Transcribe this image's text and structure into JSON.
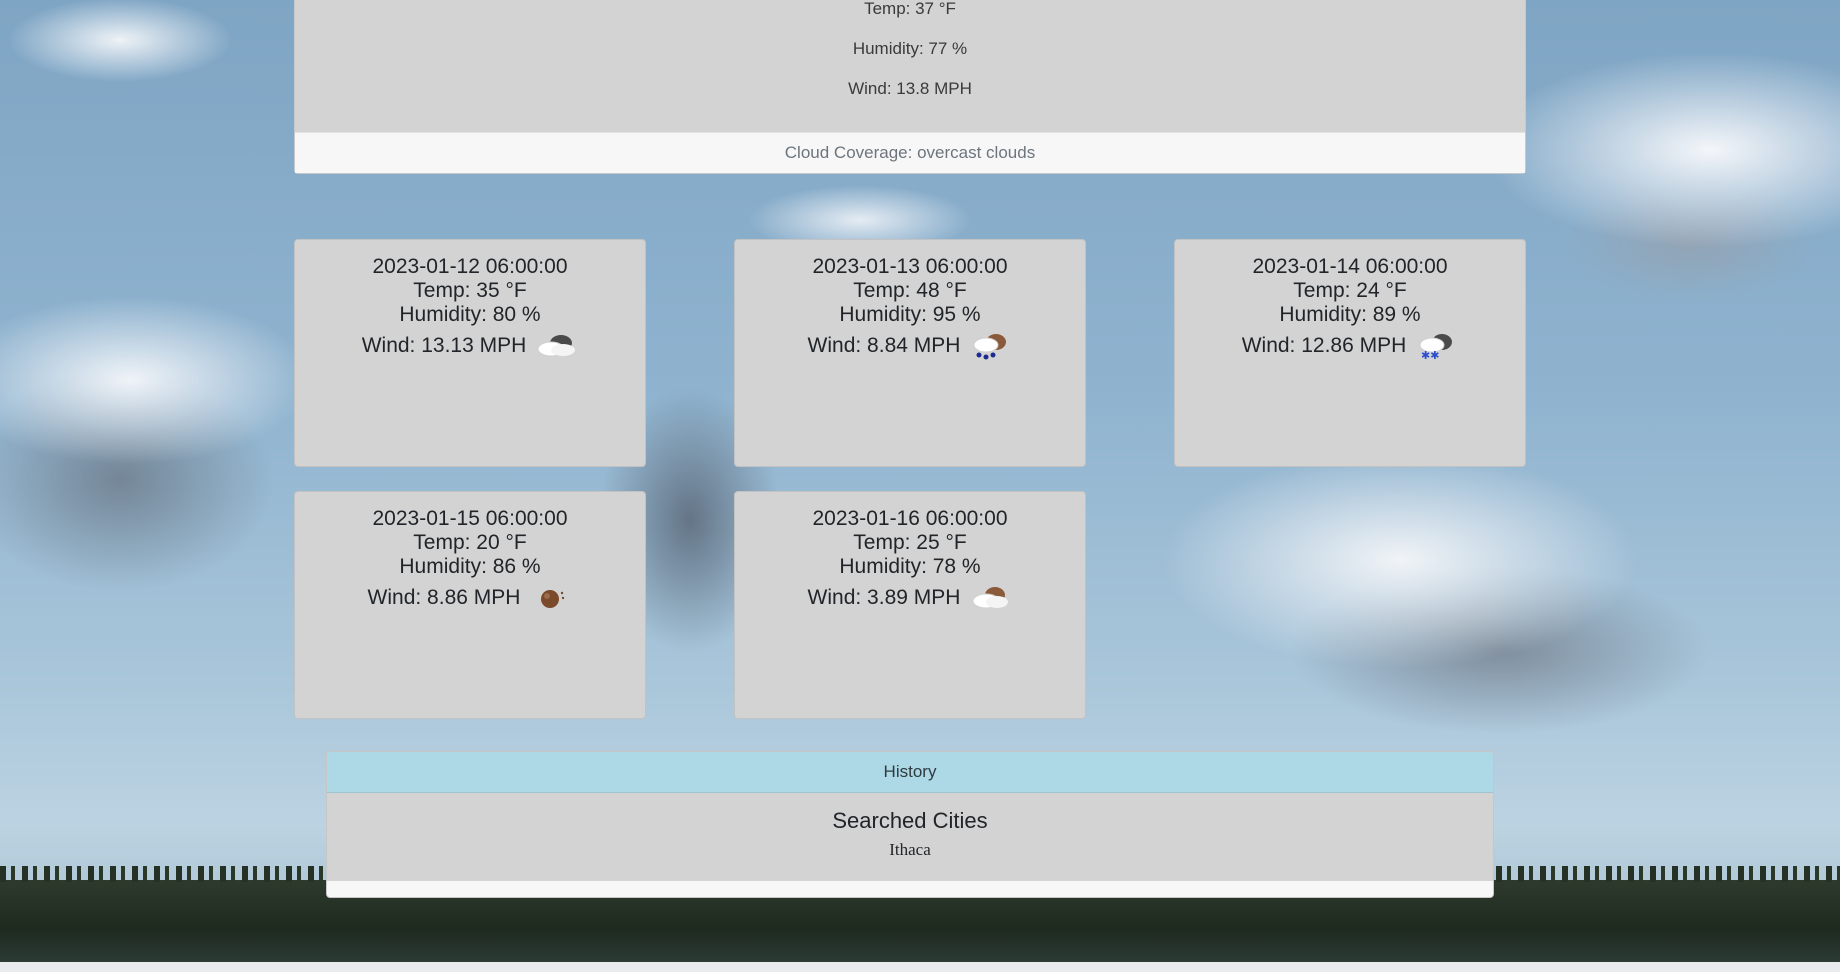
{
  "current": {
    "temp": "Temp: 37 °F",
    "humidity": "Humidity: 77 %",
    "wind": "Wind: 13.8 MPH",
    "cloud_coverage": "Cloud Coverage: overcast clouds"
  },
  "forecast": [
    {
      "date": "2023-01-12 06:00:00",
      "temp": "Temp: 35 °F",
      "humidity": "Humidity: 80 %",
      "wind": "Wind: 13.13 MPH",
      "icon": "overcast-clouds-icon"
    },
    {
      "date": "2023-01-13 06:00:00",
      "temp": "Temp: 48 °F",
      "humidity": "Humidity: 95 %",
      "wind": "Wind: 8.84 MPH",
      "icon": "rain-icon"
    },
    {
      "date": "2023-01-14 06:00:00",
      "temp": "Temp: 24 °F",
      "humidity": "Humidity: 89 %",
      "wind": "Wind: 12.86 MPH",
      "icon": "snow-icon"
    },
    {
      "date": "2023-01-15 06:00:00",
      "temp": "Temp: 20 °F",
      "humidity": "Humidity: 86 %",
      "wind": "Wind: 8.86 MPH",
      "icon": "clear-icon"
    },
    {
      "date": "2023-01-16 06:00:00",
      "temp": "Temp: 25 °F",
      "humidity": "Humidity: 78 %",
      "wind": "Wind: 3.89 MPH",
      "icon": "few-clouds-icon"
    }
  ],
  "history": {
    "header": "History",
    "title": "Searched Cities",
    "cities": [
      "Ithaca"
    ]
  },
  "colors": {
    "card_bg": "#d3d3d3",
    "history_header_bg": "#add8e6",
    "footer_bg": "#f7f7f7"
  }
}
